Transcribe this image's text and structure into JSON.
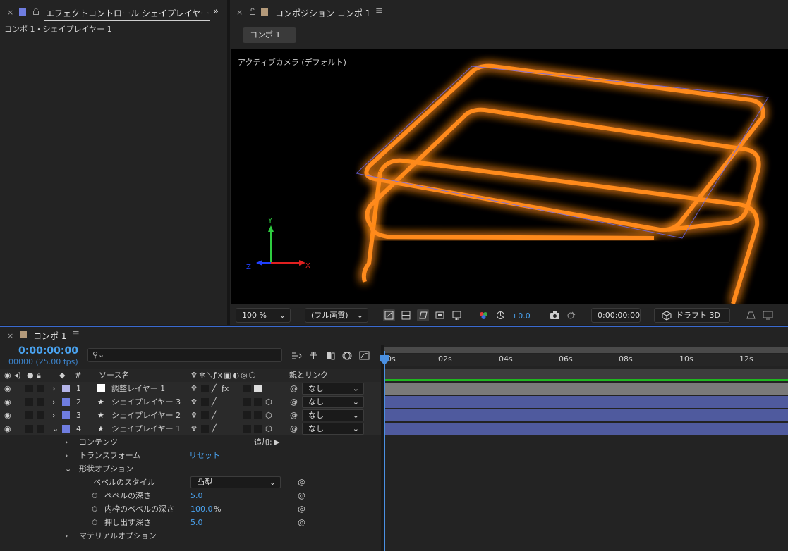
{
  "effect_panel": {
    "tab_title": "エフェクトコントロール シェイプレイヤー",
    "breadcrumb": "コンポ 1・シェイプレイヤー 1",
    "accent": "#6f7de0"
  },
  "comp_panel": {
    "tab_title": "コンポジション コンポ 1",
    "comp_tab": "コンポ 1",
    "camera_label": "アクティブカメラ (デフォルト)",
    "axes": {
      "x": "X",
      "y": "Y",
      "z": "Z"
    },
    "shape_color": "#ff8a1a"
  },
  "viewer_toolbar": {
    "zoom": "100 %",
    "resolution": "(フル画質)",
    "exposure": "+0.0",
    "timecode": "0:00:00:00",
    "renderer": "ドラフト 3D"
  },
  "timeline": {
    "tab_title": "コンポ 1",
    "timecode": "0:00:00:00",
    "frames": "00000 (25.00 fps)",
    "search_placeholder": "",
    "col_source": "ソース名",
    "col_parent": "親とリンク",
    "col_num": "#",
    "ruler": [
      "0s",
      "02s",
      "04s",
      "06s",
      "08s",
      "10s",
      "12s"
    ],
    "layers": [
      {
        "num": "1",
        "name": "調整レイヤー 1",
        "color": "#b4b4e8",
        "parent": "なし",
        "icon": "solid-white-icon",
        "bar": "#7a7a7a"
      },
      {
        "num": "2",
        "name": "シェイプレイヤー 3",
        "color": "#6f7de0",
        "parent": "なし",
        "icon": "star-icon",
        "bar": "#4f5a9e"
      },
      {
        "num": "3",
        "name": "シェイプレイヤー 2",
        "color": "#6f7de0",
        "parent": "なし",
        "icon": "star-icon",
        "bar": "#4f5a9e"
      },
      {
        "num": "4",
        "name": "シェイプレイヤー 1",
        "color": "#6f7de0",
        "parent": "なし",
        "icon": "star-icon",
        "bar": "#4f5a9e"
      }
    ],
    "props": {
      "contents": "コンテンツ",
      "add": "追加:",
      "transform": "トランスフォーム",
      "reset": "リセット",
      "shape_options": "形状オプション",
      "bevel_style": "ベベルのスタイル",
      "bevel_style_value": "凸型",
      "bevel_depth": "ベベルの深さ",
      "bevel_depth_value": "5.0",
      "inner_bevel": "内枠のベベルの深さ",
      "inner_bevel_value": "100.0",
      "inner_bevel_unit": "%",
      "extrude": "押し出す深さ",
      "extrude_value": "5.0",
      "material": "マテリアルオプション"
    }
  }
}
